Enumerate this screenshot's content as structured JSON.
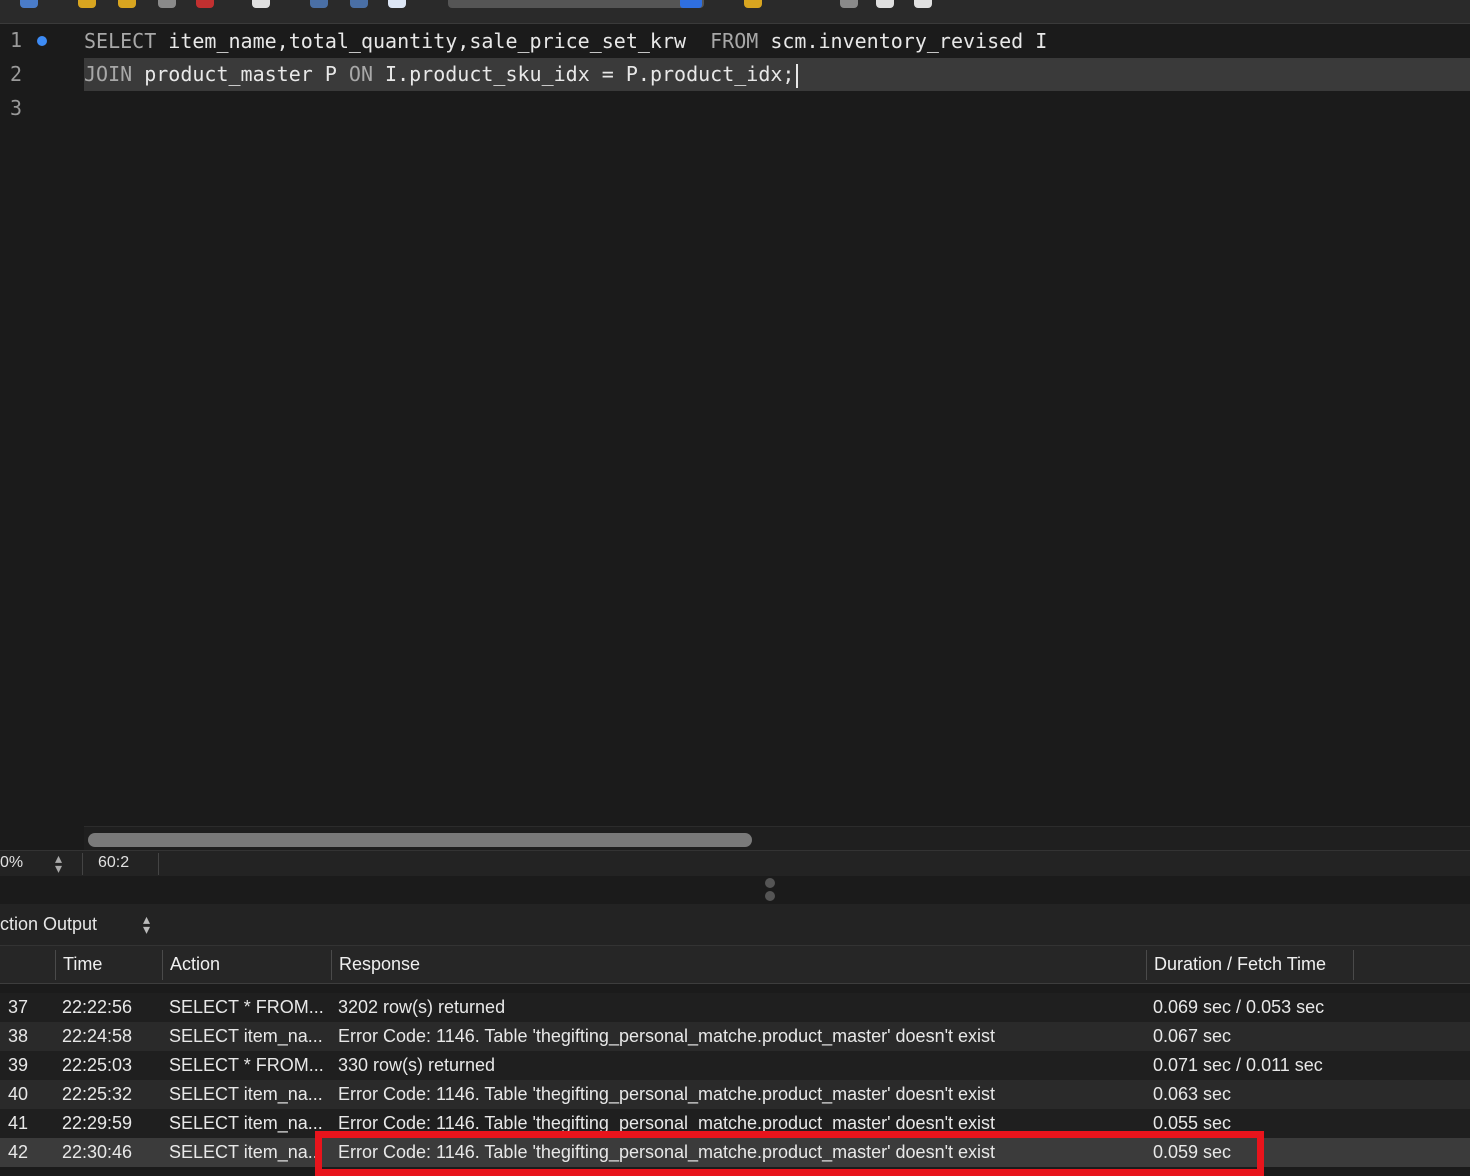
{
  "editor": {
    "lines": [
      {
        "number": "1",
        "keyword1": "SELECT",
        "text1": " item_name,total_quantity,sale_price_set_krw  ",
        "keyword2": "FROM",
        "text2": " scm.inventory_revised I"
      },
      {
        "number": "2",
        "keyword1": "JOIN",
        "text1": " product_master P ",
        "keyword2": "ON",
        "text2": " I.product_sku_idx = P.product_idx;"
      },
      {
        "number": "3"
      }
    ]
  },
  "statusbar": {
    "zoom": "0%",
    "cursor_position": "60:2"
  },
  "output": {
    "title": "ction Output"
  },
  "table": {
    "columns": [
      "Time",
      "Action",
      "Response",
      "Duration / Fetch Time"
    ],
    "rows": [
      {
        "num": "37",
        "time": "22:22:56",
        "action": "SELECT * FROM...",
        "response": "3202 row(s) returned",
        "duration": "0.069 sec / 0.053 sec"
      },
      {
        "num": "38",
        "time": "22:24:58",
        "action": "SELECT item_na...",
        "response": "Error Code: 1146. Table 'thegifting_personal_matche.product_master' doesn't exist",
        "duration": "0.067 sec"
      },
      {
        "num": "39",
        "time": "22:25:03",
        "action": "SELECT * FROM...",
        "response": "330 row(s) returned",
        "duration": "0.071 sec / 0.011 sec"
      },
      {
        "num": "40",
        "time": "22:25:32",
        "action": "SELECT item_na...",
        "response": "Error Code: 1146. Table 'thegifting_personal_matche.product_master' doesn't exist",
        "duration": "0.063 sec"
      },
      {
        "num": "41",
        "time": "22:29:59",
        "action": "SELECT item_na...",
        "response": "Error Code: 1146. Table 'thegifting_personal_matche.product_master' doesn't exist",
        "duration": "0.055 sec"
      },
      {
        "num": "42",
        "time": "22:30:46",
        "action": "SELECT item_na...",
        "response": "Error Code: 1146. Table 'thegifting_personal_matche.product_master' doesn't exist",
        "duration": "0.059 sec"
      }
    ]
  },
  "colors": {
    "background": "#1b1b1b",
    "highlight": "#e8141c",
    "marker": "#3d8bf5"
  }
}
